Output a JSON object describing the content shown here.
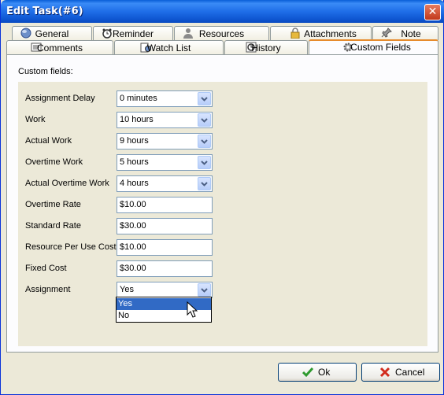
{
  "window": {
    "title": "Edit Task(#6)",
    "close_glyph": "✕"
  },
  "tabs_row1": [
    {
      "label": "General",
      "icon": "globe-icon"
    },
    {
      "label": "Reminder",
      "icon": "alarm-clock-icon"
    },
    {
      "label": "Resources",
      "icon": "user-icon"
    },
    {
      "label": "Attachments",
      "icon": "lock-icon"
    },
    {
      "label": "Note",
      "icon": "pin-icon"
    }
  ],
  "tabs_row2": [
    {
      "label": "Comments",
      "icon": "comments-icon"
    },
    {
      "label": "Watch List",
      "icon": "watch-list-icon"
    },
    {
      "label": "History",
      "icon": "history-icon"
    },
    {
      "label": "Custom Fields",
      "icon": "gear-icon",
      "active": true
    }
  ],
  "custom_fields": {
    "caption": "Custom fields:",
    "fields": [
      {
        "label": "Assignment Delay",
        "value": "0 minutes",
        "type": "combo"
      },
      {
        "label": "Work",
        "value": "10 hours",
        "type": "combo"
      },
      {
        "label": "Actual Work",
        "value": "9 hours",
        "type": "combo"
      },
      {
        "label": "Overtime Work",
        "value": "5 hours",
        "type": "combo"
      },
      {
        "label": "Actual Overtime Work",
        "value": "4 hours",
        "type": "combo"
      },
      {
        "label": "Overtime Rate",
        "value": "$10.00",
        "type": "text"
      },
      {
        "label": "Standard Rate",
        "value": "$30.00",
        "type": "text"
      },
      {
        "label": "Resource Per Use Cost",
        "value": "$10.00",
        "type": "text"
      },
      {
        "label": "Fixed Cost",
        "value": "$30.00",
        "type": "text"
      },
      {
        "label": "Assignment",
        "value": "Yes",
        "type": "combo"
      }
    ],
    "assignment_options": [
      "Yes",
      "No"
    ],
    "assignment_highlighted": "Yes"
  },
  "buttons": {
    "ok": "Ok",
    "cancel": "Cancel"
  },
  "colors": {
    "title_bar": "#1F6EE8",
    "selection": "#316AC5",
    "active_tab_accent": "#E68B2C"
  }
}
